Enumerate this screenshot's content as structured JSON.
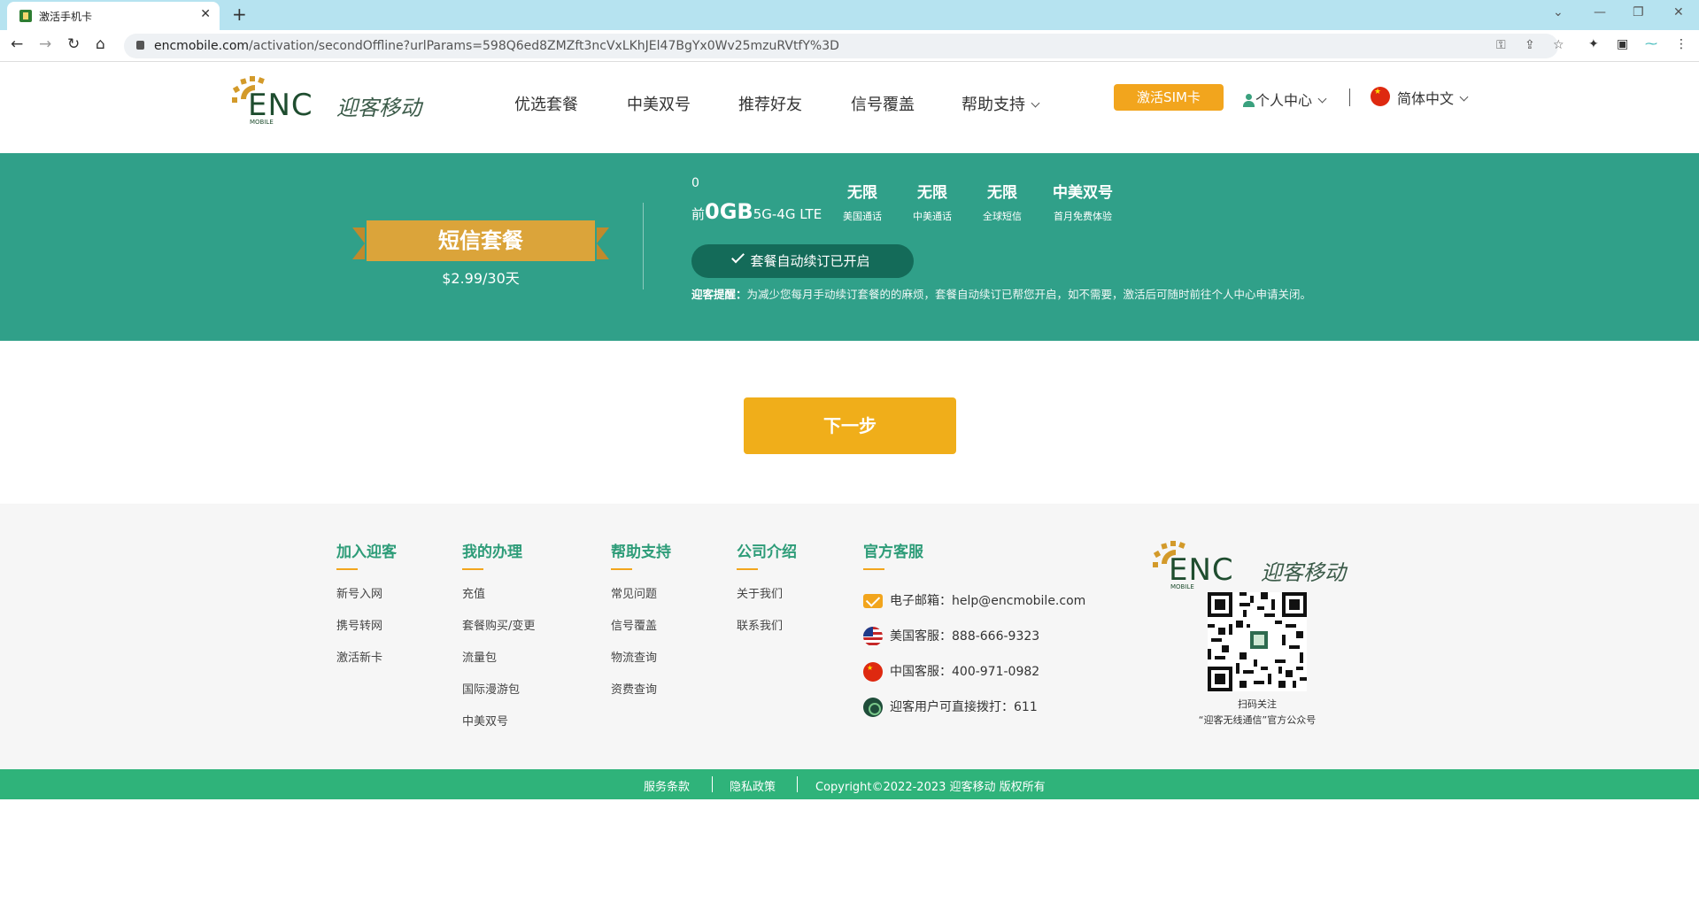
{
  "browser": {
    "tab_title": "激活手机卡",
    "url_domain": "encmobile.com",
    "url_path": "/activation/secondOffline?urlParams=598Q6ed8ZMZft3ncVxLKhJEl47BgYx0Wv25mzuRVtfY%3D"
  },
  "header": {
    "logo_text": "迎客移动",
    "logo_letters": "ENC",
    "logo_sub": "MOBILE",
    "nav": [
      "优选套餐",
      "中美双号",
      "推荐好友",
      "信号覆盖",
      "帮助支持"
    ],
    "activate_label": "激活SIM卡",
    "user_center_label": "个人中心",
    "language_label": "简体中文"
  },
  "banner": {
    "plan_name": "短信套餐",
    "plan_price": "$2.99/30天",
    "zero": "0",
    "data_prefix": "前",
    "data_amount": "0GB",
    "data_suffix": "5G-4G LTE",
    "features": [
      {
        "value": "无限",
        "label": "美国通话"
      },
      {
        "value": "无限",
        "label": "中美通话"
      },
      {
        "value": "无限",
        "label": "全球短信"
      },
      {
        "value": "中美双号",
        "label": "首月免费体验"
      }
    ],
    "renew_label": "套餐自动续订已开启",
    "notice_title": "迎客提醒：",
    "notice_text": "为减少您每月手动续订套餐的的麻烦，套餐自动续订已帮您开启，如不需要，激活后可随时前往个人中心申请关闭。"
  },
  "next_label": "下一步",
  "footer": {
    "columns": [
      {
        "title": "加入迎客",
        "items": [
          "新号入网",
          "携号转网",
          "激活新卡"
        ]
      },
      {
        "title": "我的办理",
        "items": [
          "充值",
          "套餐购买/变更",
          "流量包",
          "国际漫游包",
          "中美双号"
        ]
      },
      {
        "title": "帮助支持",
        "items": [
          "常见问题",
          "信号覆盖",
          "物流查询",
          "资费查询"
        ]
      },
      {
        "title": "公司介绍",
        "items": [
          "关于我们",
          "联系我们"
        ]
      }
    ],
    "service_title": "官方客服",
    "contacts": [
      {
        "icon": "mail-icon",
        "label": "电子邮箱：",
        "value": "help@encmobile.com"
      },
      {
        "icon": "us-flag-icon",
        "label": "美国客服：",
        "value": "888-666-9323"
      },
      {
        "icon": "cn-flag-icon",
        "label": "中国客服：",
        "value": "400-971-0982"
      },
      {
        "icon": "enc-icon",
        "label": "迎客用户可直接拨打：",
        "value": "611"
      }
    ],
    "qr_caption_1": "扫码关注",
    "qr_caption_2": "“迎客无线通信”官方公众号",
    "bottom": {
      "terms": "服务条款",
      "privacy": "隐私政策",
      "copyright": "Copyright©2022-2023 迎客移动 版权所有"
    }
  },
  "colors": {
    "banner_green": "#30a089",
    "accent_orange": "#f0ae1a",
    "footer_title_green": "#2d9c78",
    "bottom_bar_green": "#2fb37a"
  }
}
